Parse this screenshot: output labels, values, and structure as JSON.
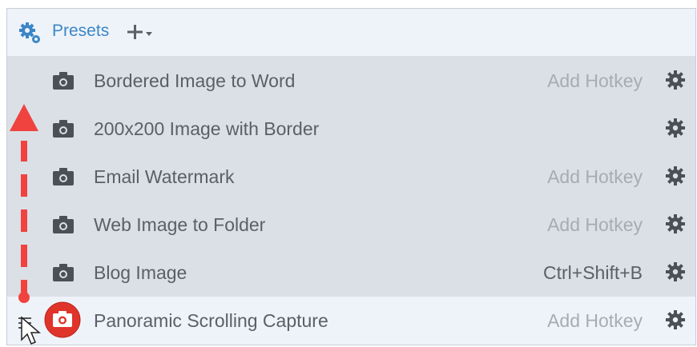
{
  "header": {
    "title": "Presets",
    "add_icon": "plus-dropdown-icon"
  },
  "presets": [
    {
      "label": "Bordered Image to Word",
      "hotkey": "Add Hotkey",
      "hotkey_set": false
    },
    {
      "label": "200x200 Image with Border",
      "hotkey": "",
      "hotkey_set": false
    },
    {
      "label": "Email Watermark",
      "hotkey": "Add Hotkey",
      "hotkey_set": false
    },
    {
      "label": "Web Image to Folder",
      "hotkey": "Add Hotkey",
      "hotkey_set": false
    },
    {
      "label": "Blog Image",
      "hotkey": "Ctrl+Shift+B",
      "hotkey_set": true
    },
    {
      "label": "Panoramic Scrolling Capture",
      "hotkey": "Add Hotkey",
      "hotkey_set": false,
      "active": true
    }
  ],
  "colors": {
    "accent": "#3b86c7",
    "record": "#e0342b",
    "arrow": "#f0433f"
  }
}
